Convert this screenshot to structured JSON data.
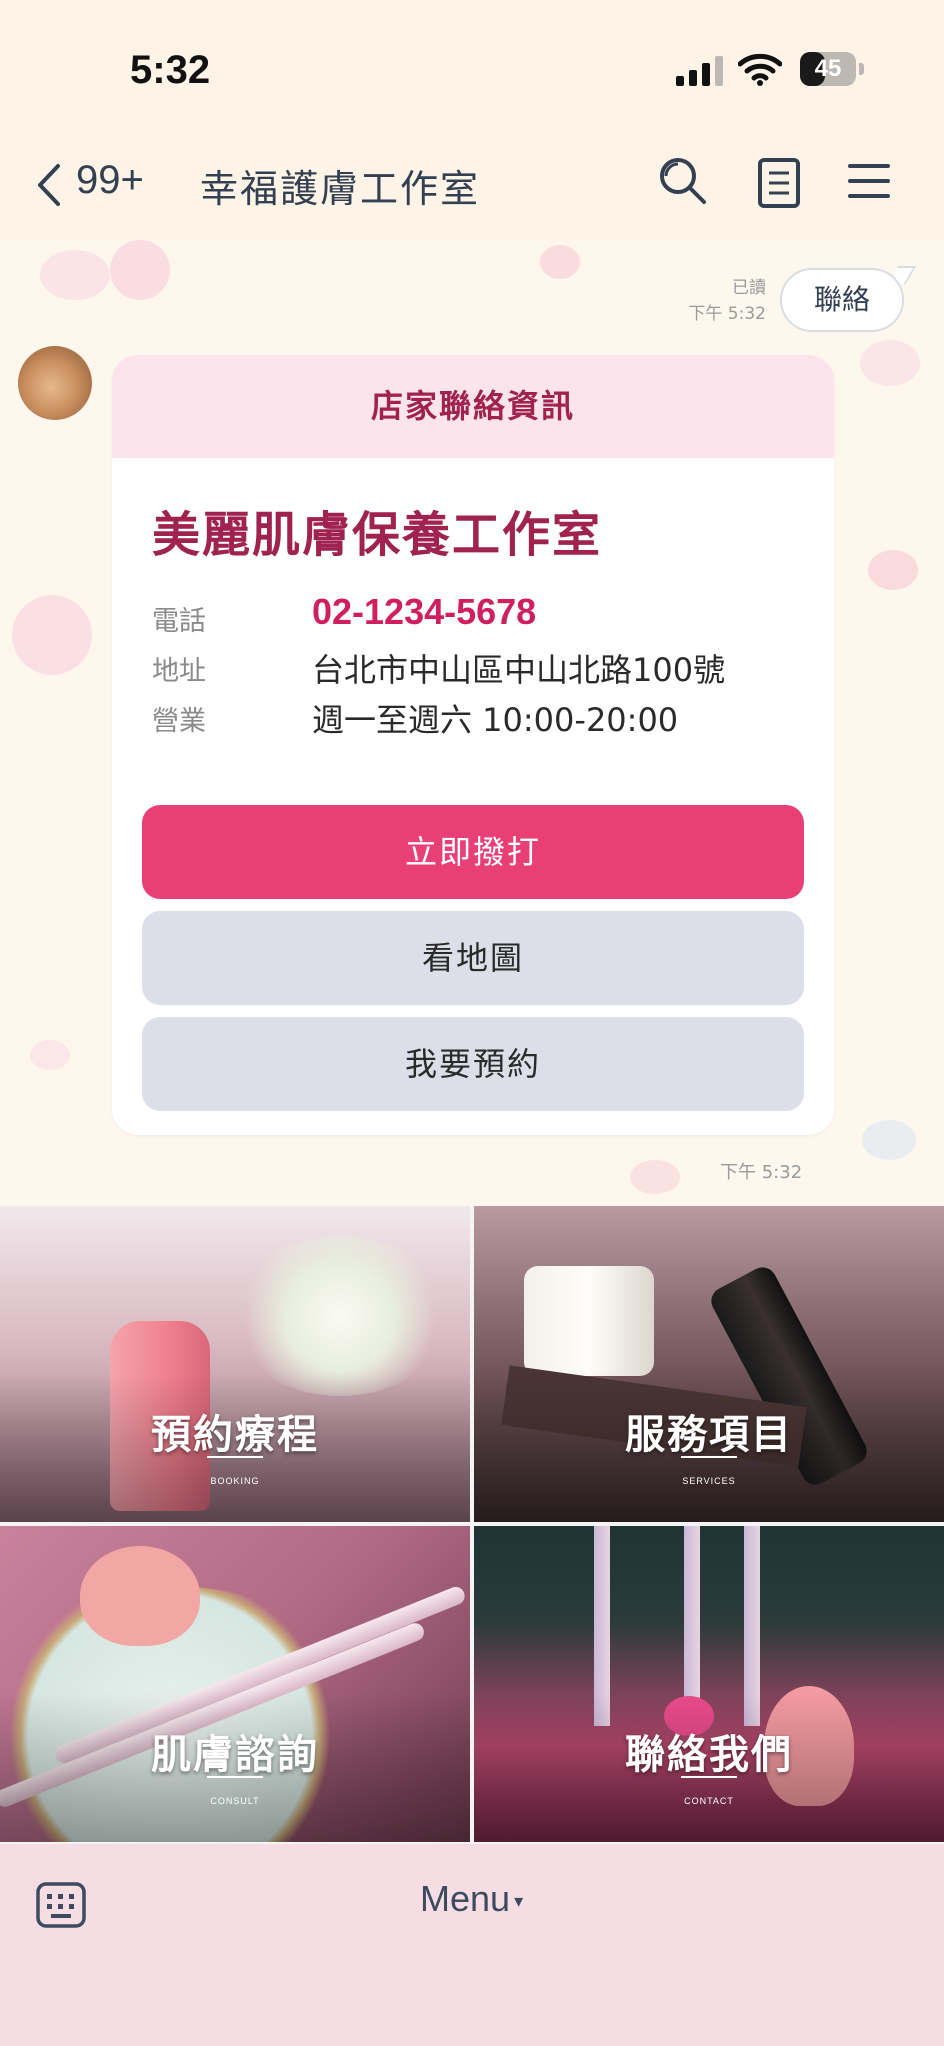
{
  "status_bar": {
    "time": "5:32",
    "battery_level": "45",
    "battery_fraction": 0.45
  },
  "header": {
    "back_icon": "chevron-left-icon",
    "unread_count": "99+",
    "title": "幸福護膚工作室",
    "icons": [
      "search-icon",
      "notes-icon",
      "menu-icon"
    ]
  },
  "chat": {
    "sent_message": {
      "read_status": "已讀",
      "time": "下午 5:32",
      "text": "聯絡"
    },
    "received_card": {
      "header": "店家聯絡資訊",
      "shop_name": "美麗肌膚保養工作室",
      "rows": [
        {
          "label": "電話",
          "value": "02-1234-5678"
        },
        {
          "label": "地址",
          "value": "台北市中山區中山北路100號"
        },
        {
          "label": "營業",
          "value": "週一至週六 10:00-20:00"
        }
      ],
      "buttons": {
        "call": "立即撥打",
        "map": "看地圖",
        "book": "我要預約"
      },
      "time": "下午 5:32"
    }
  },
  "rich_menu": {
    "tiles": [
      {
        "title": "預約療程",
        "subtitle": "BOOKING"
      },
      {
        "title": "服務項目",
        "subtitle": "SERVICES"
      },
      {
        "title": "肌膚諮詢",
        "subtitle": "CONSULT"
      },
      {
        "title": "聯絡我們",
        "subtitle": "CONTACT"
      }
    ]
  },
  "bottom_bar": {
    "keyboard_icon": "keyboard-icon",
    "menu_label": "Menu",
    "menu_caret": "▾"
  },
  "colors": {
    "accent": "#e93f77",
    "brand_dark": "#a0234f",
    "header_bg": "#fdf3e6",
    "bottom_bar_bg": "#f5dde3"
  }
}
